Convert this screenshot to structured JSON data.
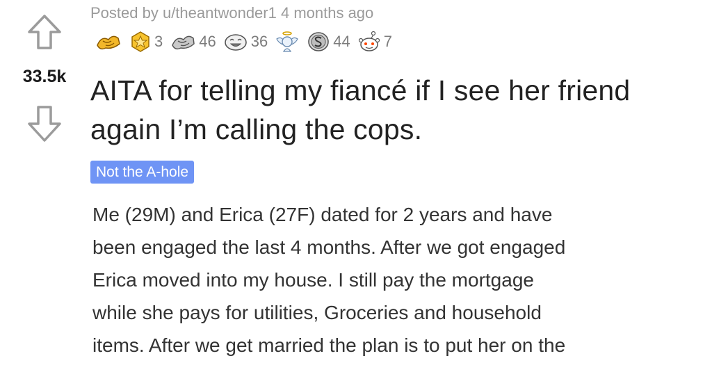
{
  "post": {
    "score": "33.5k",
    "meta": "Posted by u/theantwonder1 4 months ago",
    "awards": [
      {
        "icon": "helpful-hands-award-icon",
        "count": ""
      },
      {
        "icon": "gold-award-icon",
        "count": "3"
      },
      {
        "icon": "helpful-award-icon",
        "count": "46"
      },
      {
        "icon": "laughing-award-icon",
        "count": "36"
      },
      {
        "icon": "angel-award-icon",
        "count": ""
      },
      {
        "icon": "silver-coin-award-icon",
        "count": "44"
      },
      {
        "icon": "snoo-award-icon",
        "count": "7"
      }
    ],
    "title_line1": "AITA for telling my fiancé if I see her friend",
    "title_line2": "again I’m calling the cops.",
    "flair": "Not the A-hole",
    "flair_color": "#6f94f5",
    "body_lines": [
      "Me (29M) and Erica (27F) dated for 2 years and have",
      "been engaged the last 4 months. After we got engaged",
      "Erica moved into my house. I still pay the mortgage",
      "while she pays for utilities, Groceries and household",
      "items. After we get married the plan is to put her on the"
    ]
  }
}
